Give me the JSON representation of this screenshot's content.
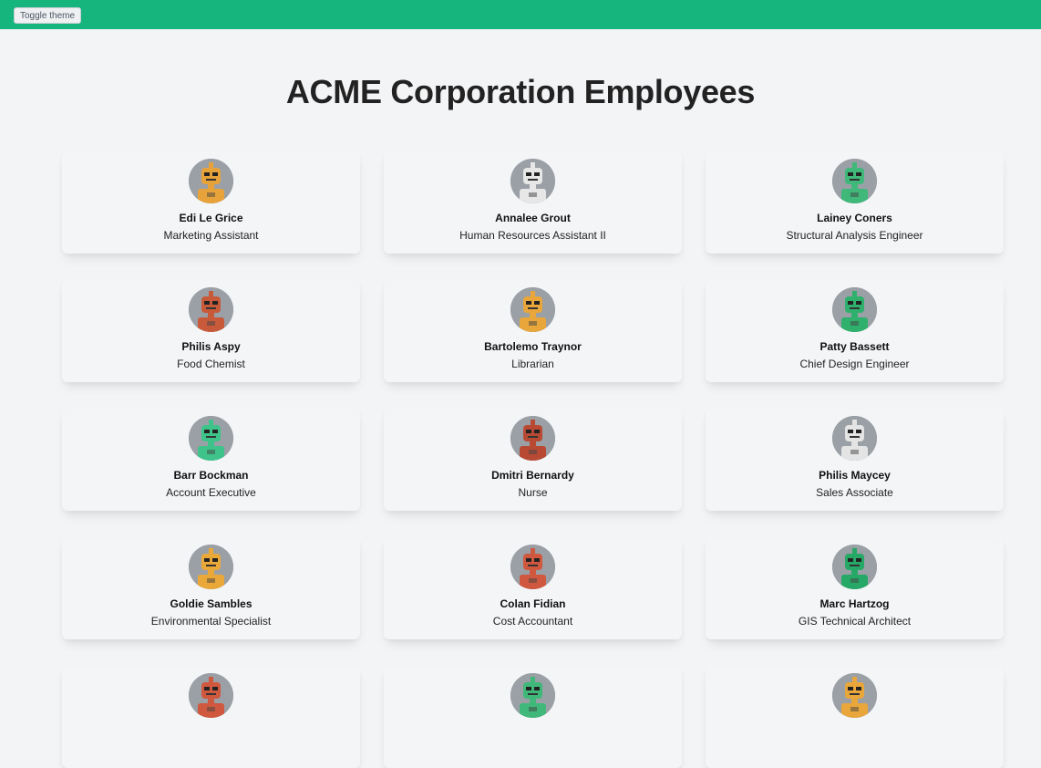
{
  "header": {
    "toggle_label": "Toggle theme",
    "accent_color": "#16b57e"
  },
  "page": {
    "title": "ACME Corporation Employees"
  },
  "employees": [
    {
      "name": "Edi Le Grice",
      "title": "Marketing Assistant",
      "avatar": "robot-avatar",
      "color": "#e8a23a"
    },
    {
      "name": "Annalee Grout",
      "title": "Human Resources Assistant II",
      "avatar": "robot-avatar",
      "color": "#e7e7e7"
    },
    {
      "name": "Lainey Coners",
      "title": "Structural Analysis Engineer",
      "avatar": "robot-avatar",
      "color": "#3fb87a"
    },
    {
      "name": "Philis Aspy",
      "title": "Food Chemist",
      "avatar": "robot-avatar",
      "color": "#c85a3a"
    },
    {
      "name": "Bartolemo Traynor",
      "title": "Librarian",
      "avatar": "robot-avatar",
      "color": "#e9a63b"
    },
    {
      "name": "Patty Bassett",
      "title": "Chief Design Engineer",
      "avatar": "robot-avatar",
      "color": "#2fb06d"
    },
    {
      "name": "Barr Bockman",
      "title": "Account Executive",
      "avatar": "robot-avatar",
      "color": "#3ec48a"
    },
    {
      "name": "Dmitri Bernardy",
      "title": "Nurse",
      "avatar": "robot-avatar",
      "color": "#b84a34"
    },
    {
      "name": "Philis Maycey",
      "title": "Sales Associate",
      "avatar": "robot-avatar",
      "color": "#e4e4e4"
    },
    {
      "name": "Goldie Sambles",
      "title": "Environmental Specialist",
      "avatar": "robot-avatar",
      "color": "#eaa838"
    },
    {
      "name": "Colan Fidian",
      "title": "Cost Accountant",
      "avatar": "robot-avatar",
      "color": "#d0583e"
    },
    {
      "name": "Marc Hartzog",
      "title": "GIS Technical Architect",
      "avatar": "robot-avatar",
      "color": "#26a866"
    },
    {
      "name": "",
      "title": "",
      "avatar": "robot-avatar",
      "color": "#d0583e"
    },
    {
      "name": "",
      "title": "",
      "avatar": "robot-avatar",
      "color": "#3fb87a"
    },
    {
      "name": "",
      "title": "",
      "avatar": "robot-avatar",
      "color": "#e9a63b"
    }
  ]
}
